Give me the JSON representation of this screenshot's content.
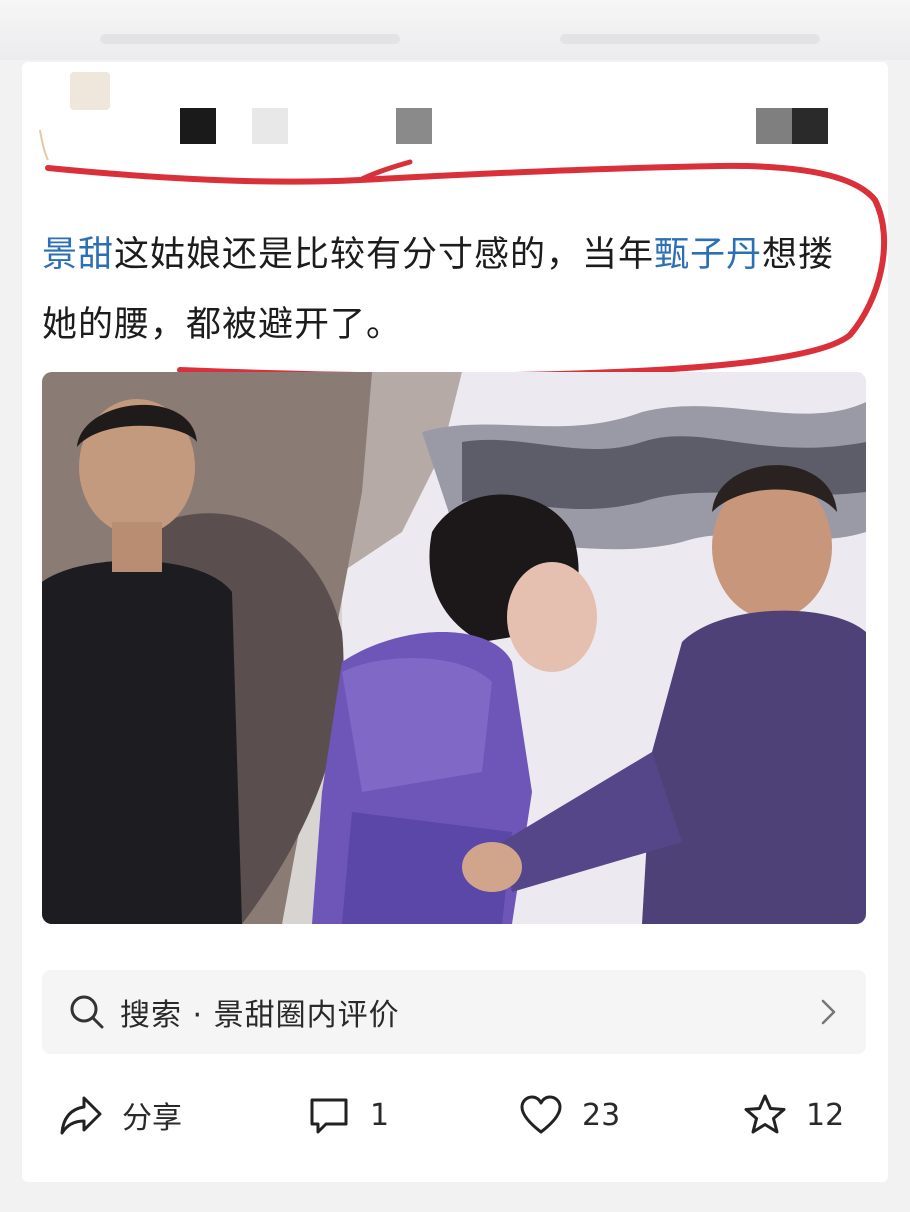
{
  "post": {
    "segments": [
      {
        "text": "景甜",
        "type": "mention"
      },
      {
        "text": "这姑娘还是比较有分寸感的，当年",
        "type": "plain"
      },
      {
        "text": "甄子丹",
        "type": "mention"
      },
      {
        "text": "想搂她的腰，都被避开了。",
        "type": "plain"
      }
    ]
  },
  "search": {
    "label": "搜索 · 景甜圈内评价",
    "icon": "search-icon",
    "chevron_icon": "chevron-right-icon"
  },
  "actions": {
    "share": {
      "label": "分享",
      "icon": "share-icon"
    },
    "comment": {
      "count": "1",
      "icon": "comment-icon"
    },
    "like": {
      "count": "23",
      "icon": "heart-icon"
    },
    "favorite": {
      "count": "12",
      "icon": "star-icon"
    }
  },
  "colors": {
    "mention": "#2d6fb5",
    "annotation": "#d9303a",
    "background": "#f2f2f3"
  }
}
